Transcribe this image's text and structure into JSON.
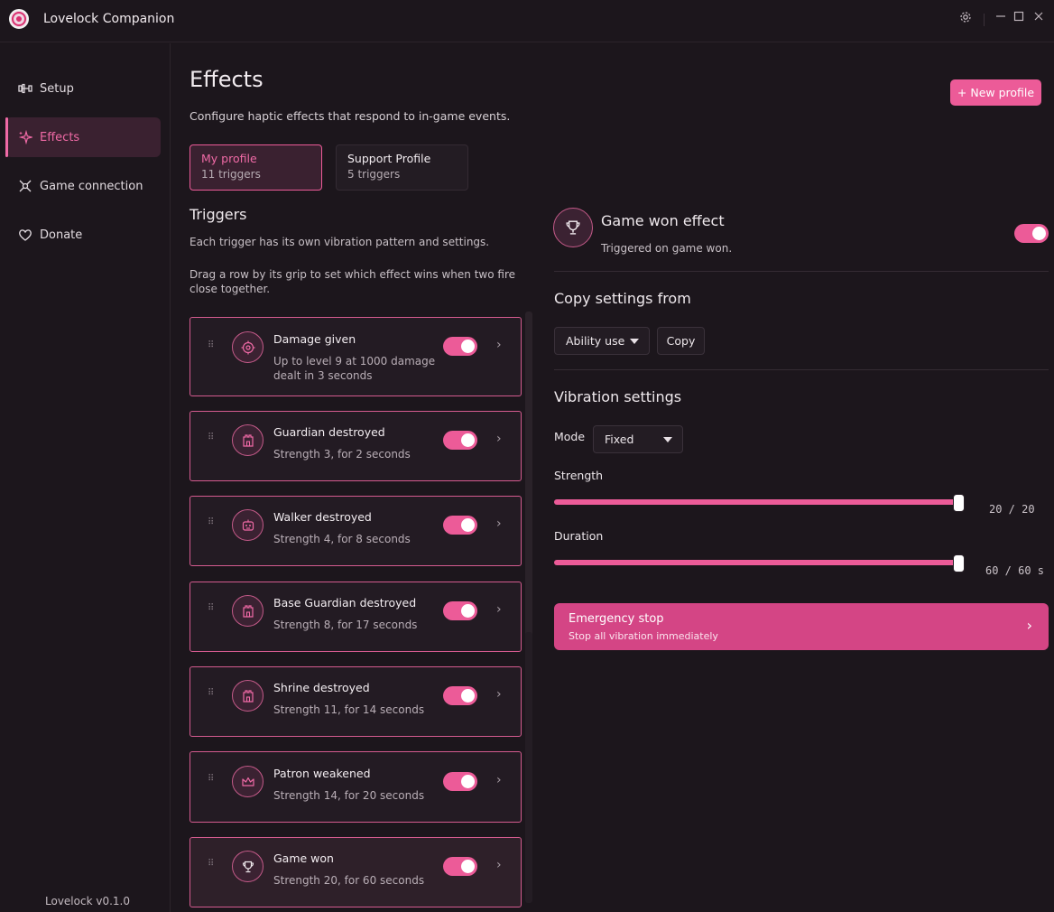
{
  "app": {
    "title": "Lovelock Companion",
    "version": "Lovelock v0.1.0"
  },
  "sidebar": {
    "items": [
      {
        "label": "Setup",
        "icon": "dumbbell-icon"
      },
      {
        "label": "Effects",
        "icon": "sparkle-icon",
        "active": true
      },
      {
        "label": "Game connection",
        "icon": "connection-icon"
      },
      {
        "label": "Donate",
        "icon": "heart-icon"
      }
    ]
  },
  "header": {
    "title": "Effects",
    "subtitle": "Configure haptic effects that respond to in-game events.",
    "new_profile_label": "+ New profile"
  },
  "profiles": [
    {
      "name": "My profile",
      "count": "11 triggers",
      "active": true
    },
    {
      "name": "Support Profile",
      "count": "5 triggers"
    }
  ],
  "triggers_section": {
    "title": "Triggers",
    "desc1": "Each trigger has its own vibration pattern and settings.",
    "desc2": "Drag a row by its grip to set which effect wins when two fire close together."
  },
  "triggers": [
    {
      "name": "Damage given",
      "desc": "Up to level 9 at 1000 damage dealt in 3 seconds",
      "icon": "target-icon",
      "enabled": true
    },
    {
      "name": "Guardian destroyed",
      "desc": "Strength 3, for 2 seconds",
      "icon": "tower-icon",
      "enabled": true
    },
    {
      "name": "Walker destroyed",
      "desc": "Strength 4, for 8 seconds",
      "icon": "robot-icon",
      "enabled": true
    },
    {
      "name": "Base Guardian destroyed",
      "desc": "Strength 8, for 17 seconds",
      "icon": "tower-icon",
      "enabled": true
    },
    {
      "name": "Shrine destroyed",
      "desc": "Strength 11, for 14 seconds",
      "icon": "tower-icon",
      "enabled": true
    },
    {
      "name": "Patron weakened",
      "desc": "Strength 14, for 20 seconds",
      "icon": "crown-icon",
      "enabled": true
    },
    {
      "name": "Game won",
      "desc": "Strength 20, for 60 seconds",
      "icon": "trophy-icon",
      "enabled": true,
      "selected": true
    }
  ],
  "detail": {
    "title": "Game won effect",
    "subtitle": "Triggered on game won.",
    "enabled": true,
    "copy": {
      "title": "Copy settings from",
      "selected": "Ability use",
      "button": "Copy"
    },
    "vibration": {
      "title": "Vibration settings",
      "mode_label": "Mode",
      "mode_value": "Fixed",
      "strength_label": "Strength",
      "strength_value": 20,
      "strength_max": 20,
      "strength_readout": "20 / 20",
      "duration_label": "Duration",
      "duration_value": 60,
      "duration_max": 60,
      "duration_readout": "60 / 60 s"
    },
    "emergency": {
      "title": "Emergency stop",
      "subtitle": "Stop all vibration immediately"
    }
  },
  "colors": {
    "accent": "#ec5b98",
    "emergency": "#d44585",
    "background": "#1c161c"
  }
}
